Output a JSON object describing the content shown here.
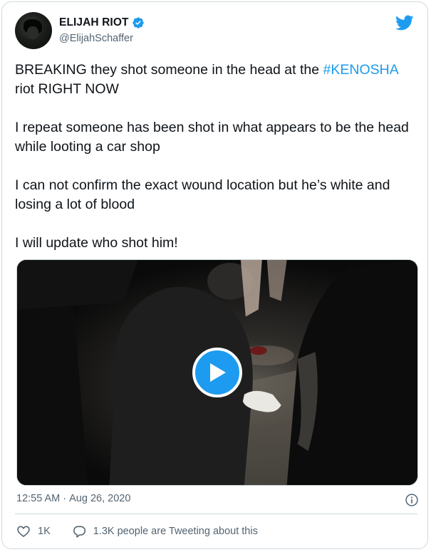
{
  "author": {
    "display_name": "ELIJAH RIOT",
    "handle": "@ElijahSchaffer",
    "verified": true
  },
  "tweet": {
    "p1_before": "BREAKING they shot someone in the head at the ",
    "p1_hashtag": "#KENOSHA",
    "p1_after": " riot RIGHT NOW",
    "p2": "I repeat someone has been shot in what appears to be the head while looting a car shop",
    "p3": "I can not confirm the exact wound location but he’s white and losing a lot of blood",
    "p4": "I will update who shot him!"
  },
  "media": {
    "type": "video",
    "play_icon": "play-icon"
  },
  "meta": {
    "time": "12:55 AM",
    "separator": "·",
    "date": "Aug 26, 2020"
  },
  "actions": {
    "likes": "1K",
    "conversation": "1.3K people are Tweeting about this"
  },
  "colors": {
    "accent": "#1d9bf0",
    "text": "#0f1419",
    "muted": "#536471",
    "border": "#cfd9de"
  },
  "icons": {
    "brand": "twitter-bird-icon",
    "verified": "verified-badge-icon",
    "info": "info-icon",
    "like": "heart-icon",
    "reply": "speech-bubble-icon"
  }
}
